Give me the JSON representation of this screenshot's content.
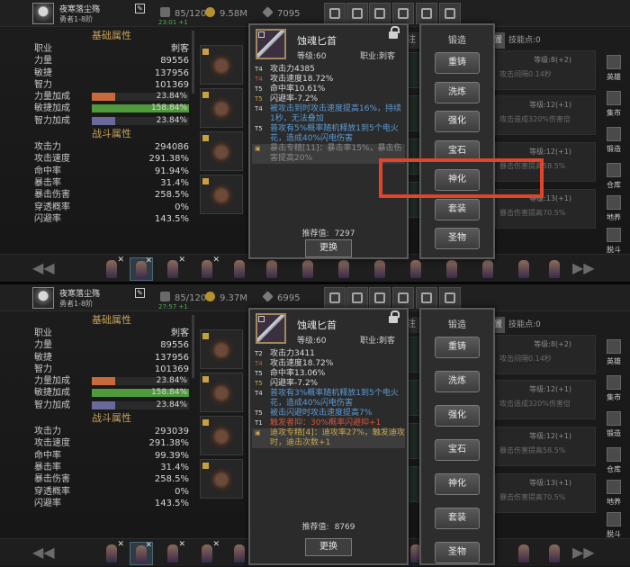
{
  "common": {
    "player_name": "夜寒落尘殇",
    "player_level": "勇者1-8阶",
    "energy_label": "85/120",
    "energy_regen": "23:01 +1",
    "energy_regen_2": "27:57 +1",
    "section_basic": "基础属性",
    "section_battle": "战斗属性",
    "forge_title": "锻造",
    "forge_buttons": [
      "重铸",
      "洗炼",
      "强化",
      "宝石",
      "神化",
      "套装",
      "圣物"
    ],
    "replace_label": "更换",
    "item_name": "蚀魂匕首",
    "item_level": "等级:60",
    "item_job": "职业:刺客",
    "score_prefix": "推荐值:",
    "bg_tab_left": "注",
    "bg_tab_right": "置",
    "skill_points": "技能点:0",
    "side_menu": [
      "英雄",
      "集市",
      "锻造",
      "仓库",
      "地养",
      "脱斗"
    ],
    "colors": {
      "accent_gold": "#c7a25a",
      "attack_blue": "#5b9bd5",
      "highlight_red": "#e0452b"
    }
  },
  "screens": [
    {
      "gold": "9.58M",
      "gems": "7095",
      "stats_basic": [
        {
          "k": "职业",
          "v": "刺客"
        },
        {
          "k": "力量",
          "v": "89556"
        },
        {
          "k": "敏捷",
          "v": "137956"
        },
        {
          "k": "智力",
          "v": "101369"
        }
      ],
      "stats_bonus": [
        {
          "k": "力量加成",
          "v": "23.84%",
          "pct": 0.24,
          "color": "#c76a3c"
        },
        {
          "k": "敏捷加成",
          "v": "158.84%",
          "pct": 1.0,
          "color": "#4f9a3a"
        },
        {
          "k": "智力加成",
          "v": "23.84%",
          "pct": 0.24,
          "color": "#6a6a9a"
        }
      ],
      "stats_battle": [
        {
          "k": "攻击力",
          "v": "294086"
        },
        {
          "k": "攻击速度",
          "v": "291.38%"
        },
        {
          "k": "命中率",
          "v": "91.94%"
        },
        {
          "k": "暴击率",
          "v": "31.4%"
        },
        {
          "k": "暴击伤害",
          "v": "258.5%"
        },
        {
          "k": "穿透概率",
          "v": "0%"
        },
        {
          "k": "闪避率",
          "v": "143.5%"
        }
      ],
      "item_lines": [
        {
          "tier": "T4",
          "tc": "white",
          "text": "攻击力4385",
          "c": "white"
        },
        {
          "tier": "T4",
          "tc": "red",
          "text": "攻击速度18.72%",
          "c": "white"
        },
        {
          "tier": "T5",
          "tc": "white",
          "text": "命中率10.61%",
          "c": "white"
        },
        {
          "tier": "T5",
          "tc": "yellow",
          "text": "闪避率-7.2%",
          "c": "white"
        },
        {
          "tier": "T4",
          "tc": "white",
          "text": "被攻击到时攻击速度提高16%，持续1秒，无法叠加",
          "c": "blue"
        },
        {
          "tier": "T5",
          "tc": "white",
          "text": "普攻有5%概率随机释放1到5个电火花，造成40%闪电伤害",
          "c": "blue"
        },
        {
          "tier": "▣",
          "tc": "yellow",
          "text": "暴击专精[11]：暴击率15%，暴击伤害提高20%",
          "c": "gray",
          "hl": true
        }
      ],
      "score": "7297",
      "skill_rows": [
        {
          "lvl": "等级:8(+2)",
          "desc": "攻击间隔0.14秒"
        },
        {
          "lvl": "等级:12(+1)",
          "desc": "攻击造成320%伤害倍"
        },
        {
          "lvl": "等级:12(+1)",
          "desc": "暴击伤害提高58.5%"
        },
        {
          "lvl": "等级:13(+1)",
          "desc": "暴击伤害提高70.5%"
        }
      ]
    },
    {
      "gold": "9.37M",
      "gems": "6995",
      "stats_basic": [
        {
          "k": "职业",
          "v": "刺客"
        },
        {
          "k": "力量",
          "v": "89556"
        },
        {
          "k": "敏捷",
          "v": "137956"
        },
        {
          "k": "智力",
          "v": "101369"
        }
      ],
      "stats_bonus": [
        {
          "k": "力量加成",
          "v": "23.84%",
          "pct": 0.24,
          "color": "#c76a3c"
        },
        {
          "k": "敏捷加成",
          "v": "158.84%",
          "pct": 1.0,
          "color": "#4f9a3a"
        },
        {
          "k": "智力加成",
          "v": "23.84%",
          "pct": 0.24,
          "color": "#6a6a9a"
        }
      ],
      "stats_battle": [
        {
          "k": "攻击力",
          "v": "293039"
        },
        {
          "k": "攻击速度",
          "v": "291.38%"
        },
        {
          "k": "命中率",
          "v": "99.39%"
        },
        {
          "k": "暴击率",
          "v": "31.4%"
        },
        {
          "k": "暴击伤害",
          "v": "258.5%"
        },
        {
          "k": "穿透概率",
          "v": "0%"
        },
        {
          "k": "闪避率",
          "v": "143.5%"
        }
      ],
      "item_lines": [
        {
          "tier": "T2",
          "tc": "white",
          "text": "攻击力3411",
          "c": "white"
        },
        {
          "tier": "T4",
          "tc": "red",
          "text": "攻击速度18.72%",
          "c": "white"
        },
        {
          "tier": "T5",
          "tc": "white",
          "text": "命中率13.06%",
          "c": "white"
        },
        {
          "tier": "T5",
          "tc": "yellow",
          "text": "闪避率-7.2%",
          "c": "white"
        },
        {
          "tier": "T4",
          "tc": "white",
          "text": "普攻有3%概率随机释放1到5个电火花，造成40%闪电伤害",
          "c": "blue"
        },
        {
          "tier": "T5",
          "tc": "white",
          "text": "被击闪避时攻击速度提高7%",
          "c": "blue"
        },
        {
          "tier": "T1",
          "tc": "white",
          "text": "触发者抑：30%概率闪避抑+1",
          "c": "red"
        },
        {
          "tier": "▣",
          "tc": "yellow",
          "text": "迪攻专精[4]：迪攻率27%，触发迪攻时，迪击次数+1",
          "c": "yellow",
          "hl": true
        }
      ],
      "score": "8769",
      "skill_rows": [
        {
          "lvl": "等级:8(+2)",
          "desc": "攻击间隔0.14秒"
        },
        {
          "lvl": "等级:12(+1)",
          "desc": "攻击造成320%伤害倍"
        },
        {
          "lvl": "等级:12(+1)",
          "desc": "暴击伤害提高58.5%"
        },
        {
          "lvl": "等级:13(+1)",
          "desc": "暴击伤害提高70.5%"
        }
      ]
    }
  ]
}
